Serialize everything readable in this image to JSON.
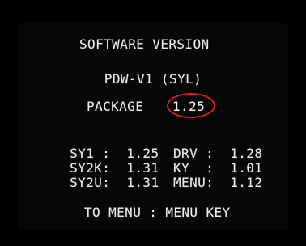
{
  "screen": {
    "title": "SOFTWARE VERSION",
    "model": "PDW-V1 (SYL)",
    "package_label": "PACKAGE",
    "package_value": "1.25",
    "versions": [
      {
        "left": "SY1 :  1.25",
        "right": "DRV :  1.28"
      },
      {
        "left": "SY2K:  1.31",
        "right": "KY  :  1.01"
      },
      {
        "left": "SY2U:  1.31",
        "right": "MENU:  1.12"
      }
    ],
    "footer": "TO MENU : MENU KEY"
  },
  "colors": {
    "background": "#000000",
    "text": "#ececec",
    "highlight_circle": "#c8201a"
  }
}
